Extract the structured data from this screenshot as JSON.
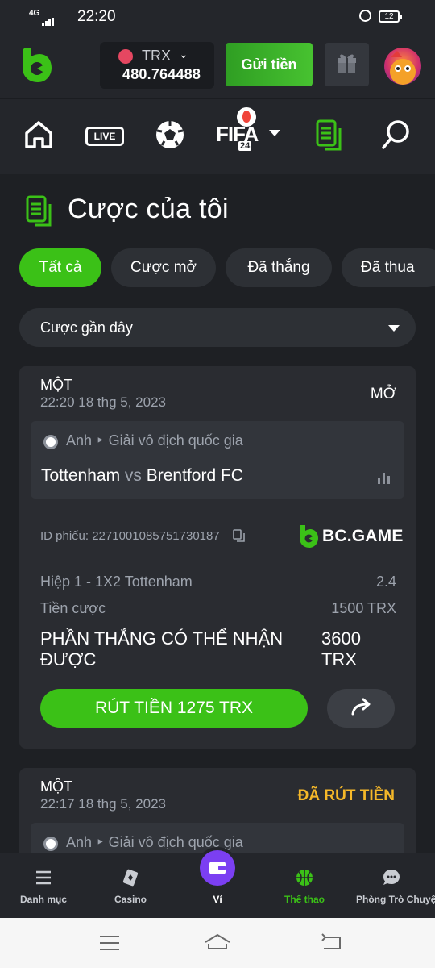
{
  "status_bar": {
    "network": "4G",
    "time": "22:20",
    "battery": "12"
  },
  "header": {
    "currency": "TRX",
    "balance": "480.764488",
    "deposit_label": "Gửi tiền"
  },
  "nav": {
    "live_label": "LIVE",
    "fifa_label": "FIFA",
    "fifa_year": "24"
  },
  "page": {
    "title": "Cược của tôi",
    "tabs": [
      {
        "label": "Tất cả",
        "active": true
      },
      {
        "label": "Cược mở",
        "active": false
      },
      {
        "label": "Đã thắng",
        "active": false
      },
      {
        "label": "Đã thua",
        "active": false
      }
    ],
    "filter_label": "Cược gần đây"
  },
  "bets": [
    {
      "type": "MỘT",
      "date": "22:20 18 thg 5, 2023",
      "status": "MỞ",
      "league_country": "Anh",
      "league_name": "Giải vô địch quốc gia",
      "home": "Tottenham",
      "vs": "vs",
      "away": "Brentford FC",
      "ticket_label": "ID phiếu: 2271001085751730187",
      "brand": "BC.GAME",
      "selection": "Hiệp 1 - 1X2 Tottenham",
      "odds": "2.4",
      "stake_label": "Tiền cược",
      "stake": "1500 TRX",
      "win_label": "PHẦN THẮNG CÓ THỂ NHẬN ĐƯỢC",
      "win_amount": "3600 TRX",
      "cashout_label": "RÚT TIỀN 1275 TRX"
    },
    {
      "type": "MỘT",
      "date": "22:17 18 thg 5, 2023",
      "status": "ĐÃ RÚT TIỀN",
      "league_country": "Anh",
      "league_name": "Giải vô địch quốc gia"
    }
  ],
  "bottom_nav": [
    {
      "label": "Danh mục",
      "icon": "menu-icon"
    },
    {
      "label": "Casino",
      "icon": "casino-icon"
    },
    {
      "label": "Ví",
      "icon": "wallet-icon"
    },
    {
      "label": "Thể thao",
      "icon": "basketball-icon",
      "active": true
    },
    {
      "label": "Phòng Trò Chuyện",
      "icon": "chat-icon"
    }
  ],
  "colors": {
    "accent": "#3bc117",
    "gold": "#f5b829",
    "wallet": "#7b3ff2",
    "bg": "#1e2024"
  }
}
